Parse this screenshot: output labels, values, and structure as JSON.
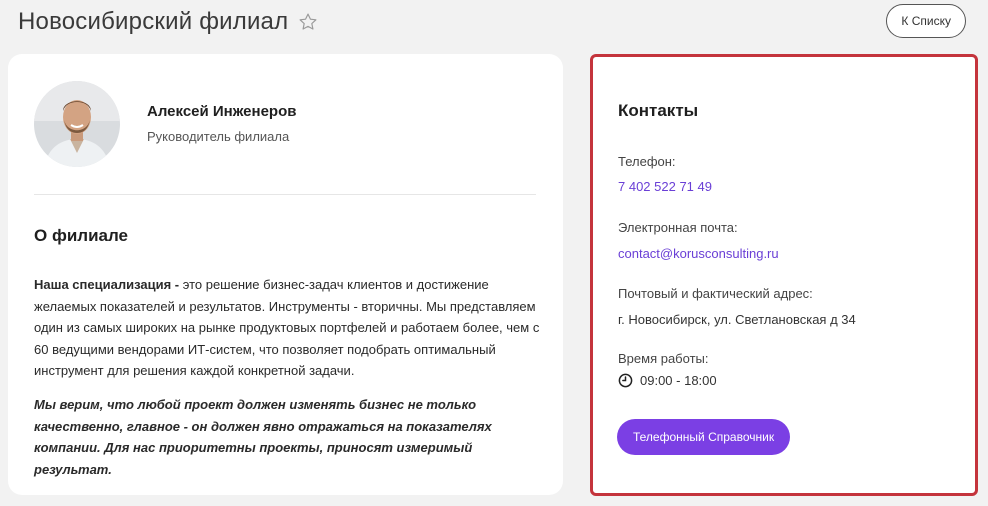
{
  "header": {
    "title": "Новосибирский филиал",
    "back_label": "К Списку"
  },
  "manager": {
    "name": "Алексей Инженеров",
    "role": "Руководитель филиала"
  },
  "about": {
    "title": "О филиале",
    "p1_bold": "Наша специализация -",
    "p1_rest": " это решение бизнес-задач клиентов и достижение желаемых показателей и результатов. Инструменты - вторичны. Мы представляем один из самых широких на рынке продуктовых портфелей и работаем более, чем с 60 ведущими вендорами ИТ-систем, что позволяет подобрать оптимальный инструмент для решения каждой конкретной задачи.",
    "p2": "Мы верим, что любой проект должен изменять бизнес не только качественно, главное - он должен явно отражаться на показателях компании. Для нас приоритетны проекты, приносят измеримый результат."
  },
  "contacts": {
    "title": "Контакты",
    "phone_label": "Телефон:",
    "phone": "7 402 522 71 49",
    "email_label": "Электронная почта:",
    "email": "contact@korusconsulting.ru",
    "address_label": "Почтовый и фактический адрес:",
    "address": "г. Новосибирск, ул. Светлановская д 34",
    "hours_label": "Время работы:",
    "hours": "09:00 - 18:00",
    "directory_button": "Телефонный Справочник"
  },
  "colors": {
    "accent": "#7b3fe4",
    "link": "#6a3fd6",
    "highlight_border": "#c4343c"
  },
  "icons": [
    "star-outline-icon",
    "clock-icon"
  ]
}
